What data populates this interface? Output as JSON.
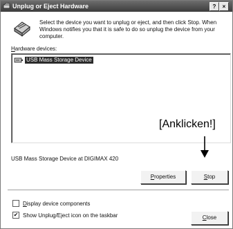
{
  "window": {
    "title": "Unplug or Eject Hardware",
    "help_button": "?",
    "close_button": "×"
  },
  "instructions": "Select the device you want to unplug or eject, and then click Stop. When Windows notifies you that it is safe to do so unplug the device from your computer.",
  "hardware_devices": {
    "label_prefix": "H",
    "label_rest": "ardware devices:",
    "items": [
      {
        "label": "USB Mass Storage Device",
        "selected": true
      }
    ]
  },
  "annotation": {
    "text": "[Anklicken!]"
  },
  "device_description": "USB Mass Storage Device at DIGIMAX 420",
  "buttons": {
    "properties_prefix": "P",
    "properties_rest": "roperties",
    "stop_prefix": "S",
    "stop_rest": "top",
    "close_prefix": "C",
    "close_rest": "lose"
  },
  "options": {
    "display_components_prefix": "D",
    "display_components_rest": "isplay device components",
    "display_components_checked": false,
    "show_icon_label": "Show Unplug/Eject icon on the taskbar",
    "show_icon_checked": true,
    "check_mark": "✔"
  },
  "icons": {
    "title": "eject-hardware-icon",
    "header": "hardware-icon",
    "device": "usb-device-icon",
    "arrow": "arrow-down-icon"
  }
}
